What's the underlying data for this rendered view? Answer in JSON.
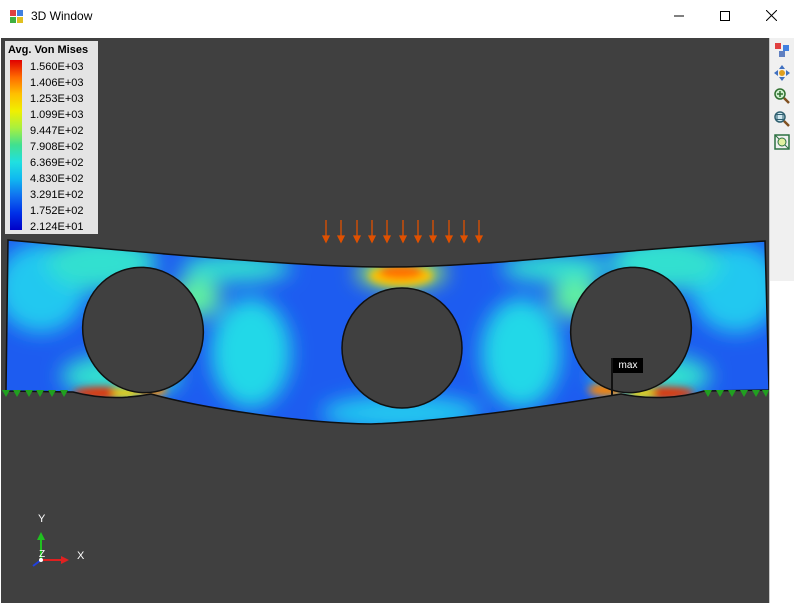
{
  "window": {
    "title": "3D Window"
  },
  "legend": {
    "title": "Avg. Von Mises",
    "values": [
      "1.560E+03",
      "1.406E+03",
      "1.253E+03",
      "1.099E+03",
      "9.447E+02",
      "7.908E+02",
      "6.369E+02",
      "4.830E+02",
      "3.291E+02",
      "1.752E+02",
      "2.124E+01"
    ]
  },
  "marker": {
    "label": "max"
  },
  "axes": {
    "y": "Y",
    "x": "X",
    "z": "Z"
  },
  "toolbar": {
    "icons": [
      "view-cube-icon",
      "pan-icon",
      "zoom-in-icon",
      "zoom-window-icon",
      "fit-all-icon"
    ]
  },
  "colors": {
    "background": "#404040",
    "stress_high": "#e00000",
    "stress_low": "#0000c8",
    "load_arrows": "#e05000",
    "supports": "#20a020"
  }
}
